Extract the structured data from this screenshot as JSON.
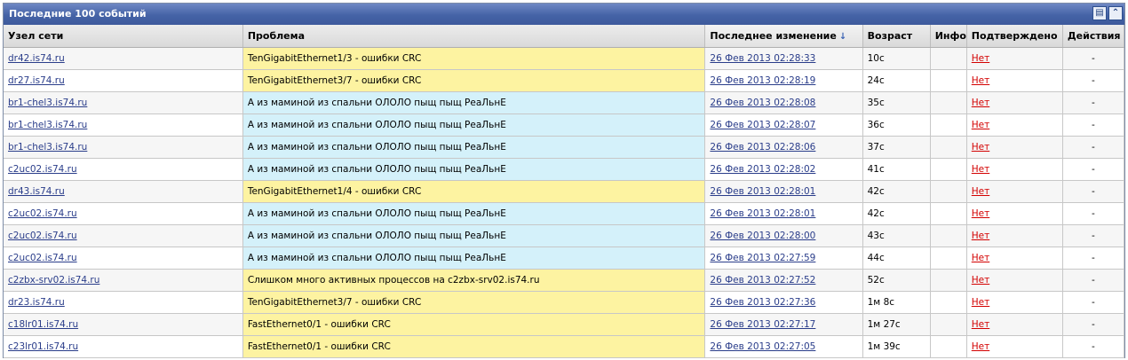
{
  "panel": {
    "title": "Последние 100 событий",
    "icons": [
      "list-icon",
      "collapse-icon"
    ]
  },
  "columns": [
    "Узел сети",
    "Проблема",
    "Последнее изменение",
    "Возраст",
    "Инфо",
    "Подтверждено",
    "Действия"
  ],
  "rows": [
    {
      "host": "dr42.is74.ru",
      "problem": "TenGigabitEthernet1/3 - ошибки CRC",
      "severity": "yellow",
      "last_change": "26 Фев 2013 02:28:33",
      "age": "10с",
      "info": "",
      "ack": "Нет",
      "actions": "-"
    },
    {
      "host": "dr27.is74.ru",
      "problem": "TenGigabitEthernet3/7 - ошибки CRC",
      "severity": "yellow",
      "last_change": "26 Фев 2013 02:28:19",
      "age": "24с",
      "info": "",
      "ack": "Нет",
      "actions": "-"
    },
    {
      "host": "br1-chel3.is74.ru",
      "problem": "А из маминой из спальни ОЛОЛО пыщ пыщ РеаЛьнЕ",
      "severity": "blue",
      "last_change": "26 Фев 2013 02:28:08",
      "age": "35с",
      "info": "",
      "ack": "Нет",
      "actions": "-"
    },
    {
      "host": "br1-chel3.is74.ru",
      "problem": "А из маминой из спальни ОЛОЛО пыщ пыщ РеаЛьнЕ",
      "severity": "blue",
      "last_change": "26 Фев 2013 02:28:07",
      "age": "36с",
      "info": "",
      "ack": "Нет",
      "actions": "-"
    },
    {
      "host": "br1-chel3.is74.ru",
      "problem": "А из маминой из спальни ОЛОЛО пыщ пыщ РеаЛьнЕ",
      "severity": "blue",
      "last_change": "26 Фев 2013 02:28:06",
      "age": "37с",
      "info": "",
      "ack": "Нет",
      "actions": "-"
    },
    {
      "host": "c2uc02.is74.ru",
      "problem": "А из маминой из спальни ОЛОЛО пыщ пыщ РеаЛьнЕ",
      "severity": "blue",
      "last_change": "26 Фев 2013 02:28:02",
      "age": "41с",
      "info": "",
      "ack": "Нет",
      "actions": "-"
    },
    {
      "host": "dr43.is74.ru",
      "problem": "TenGigabitEthernet1/4 - ошибки CRC",
      "severity": "yellow",
      "last_change": "26 Фев 2013 02:28:01",
      "age": "42с",
      "info": "",
      "ack": "Нет",
      "actions": "-"
    },
    {
      "host": "c2uc02.is74.ru",
      "problem": "А из маминой из спальни ОЛОЛО пыщ пыщ РеаЛьнЕ",
      "severity": "blue",
      "last_change": "26 Фев 2013 02:28:01",
      "age": "42с",
      "info": "",
      "ack": "Нет",
      "actions": "-"
    },
    {
      "host": "c2uc02.is74.ru",
      "problem": "А из маминой из спальни ОЛОЛО пыщ пыщ РеаЛьнЕ",
      "severity": "blue",
      "last_change": "26 Фев 2013 02:28:00",
      "age": "43с",
      "info": "",
      "ack": "Нет",
      "actions": "-"
    },
    {
      "host": "c2uc02.is74.ru",
      "problem": "А из маминой из спальни ОЛОЛО пыщ пыщ РеаЛьнЕ",
      "severity": "blue",
      "last_change": "26 Фев 2013 02:27:59",
      "age": "44с",
      "info": "",
      "ack": "Нет",
      "actions": "-"
    },
    {
      "host": "c2zbx-srv02.is74.ru",
      "problem": "Слишком много активных процессов на c2zbx-srv02.is74.ru",
      "severity": "yellow",
      "last_change": "26 Фев 2013 02:27:52",
      "age": "52с",
      "info": "",
      "ack": "Нет",
      "actions": "-"
    },
    {
      "host": "dr23.is74.ru",
      "problem": "TenGigabitEthernet3/7 - ошибки CRC",
      "severity": "yellow",
      "last_change": "26 Фев 2013 02:27:36",
      "age": "1м 8с",
      "info": "",
      "ack": "Нет",
      "actions": "-"
    },
    {
      "host": "c18lr01.is74.ru",
      "problem": "FastEthernet0/1 - ошибки CRC",
      "severity": "yellow",
      "last_change": "26 Фев 2013 02:27:17",
      "age": "1м 27с",
      "info": "",
      "ack": "Нет",
      "actions": "-"
    },
    {
      "host": "c23lr01.is74.ru",
      "problem": "FastEthernet0/1 - ошибки CRC",
      "severity": "yellow",
      "last_change": "26 Фев 2013 02:27:05",
      "age": "1м 39с",
      "info": "",
      "ack": "Нет",
      "actions": "-"
    }
  ],
  "colors": {
    "yellow": "#fdf3a1",
    "blue": "#d4f1fa",
    "ack_no": "#d30000",
    "link": "#2a3d8a",
    "header": "#4563a6"
  }
}
